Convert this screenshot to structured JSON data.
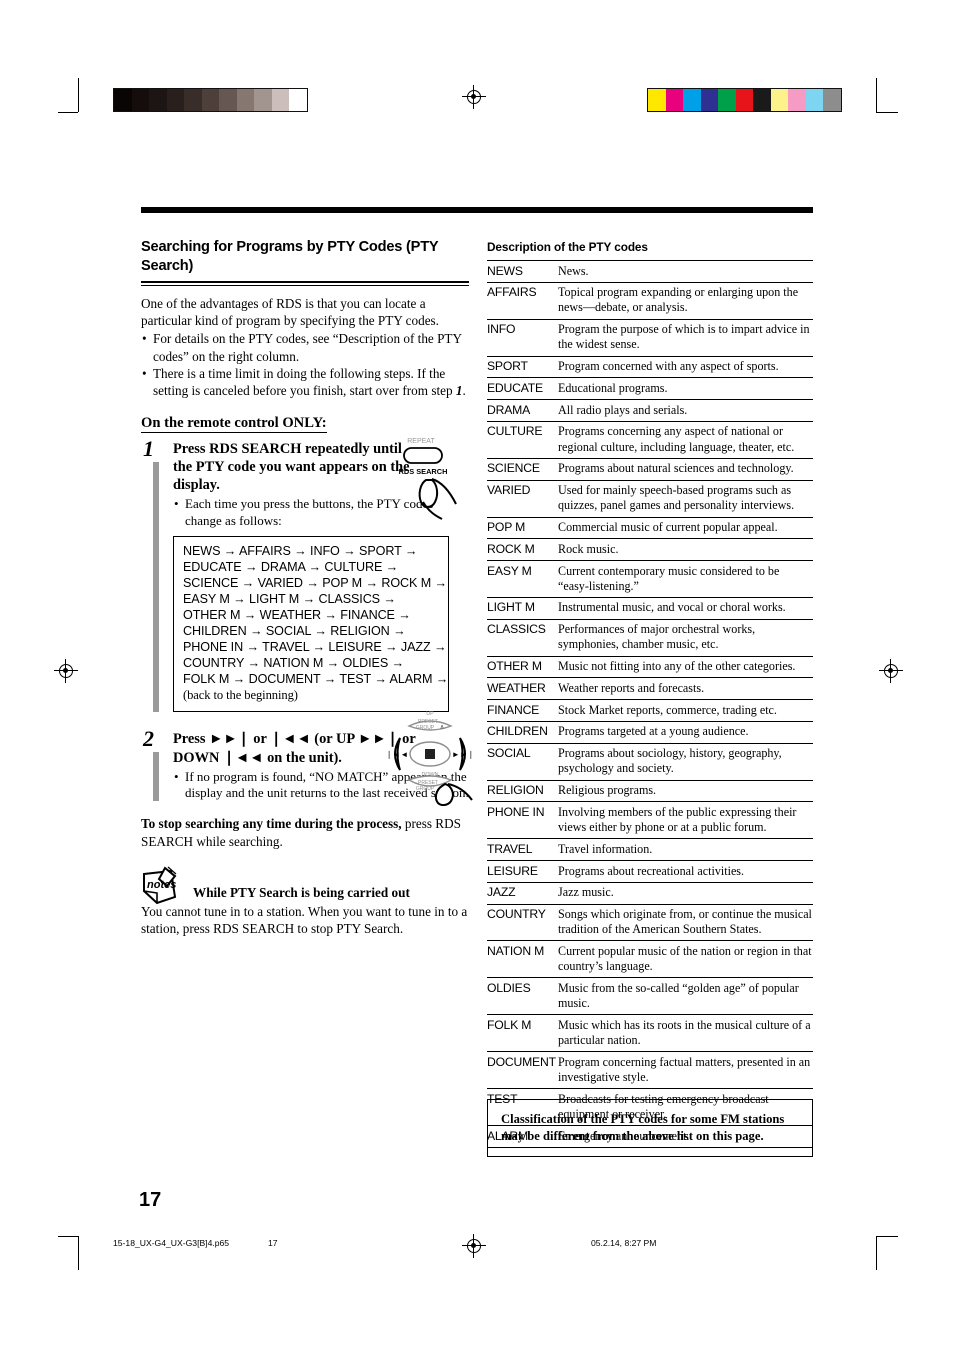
{
  "registration": {
    "gray_ramp": [
      "#0a0505",
      "#140d0c",
      "#1d1513",
      "#291f1d",
      "#392d29",
      "#4d3f3a",
      "#665752",
      "#867771",
      "#a2948f",
      "#cbbebb",
      "#ffffff"
    ],
    "color_patches": [
      "#ffe800",
      "#e8007d",
      "#00a0e9",
      "#2e3192",
      "#00a04b",
      "#e7141a",
      "#1a1a1a",
      "#fdf18c",
      "#f59bc4",
      "#7ed5f2",
      "#8d8d8d"
    ]
  },
  "left": {
    "title": "Searching for Programs by PTY Codes (PTY Search)",
    "intro": "One of the advantages of RDS is that you can locate a particular kind of program by specifying the PTY codes.",
    "intro_bullets": [
      "For details on the PTY codes, see “Description of the PTY codes” on the right column.",
      "There is a time limit in doing the following steps. If the setting is canceled before you finish, start over from step "
    ],
    "bullet2_step_ref": "1",
    "bullet2_tail": ".",
    "remote_only_heading": "On the remote control ONLY:",
    "step1": {
      "number": "1",
      "heading": "Press RDS SEARCH repeatedly until the PTY code you want appears on the display.",
      "bullet": "Each time you press the buttons, the PTY codes change as follows:"
    },
    "flow": {
      "lines": [
        "NEWS → AFFAIRS → INFO → SPORT →",
        "EDUCATE → DRAMA → CULTURE →",
        "SCIENCE → VARIED → POP M → ROCK M →",
        "EASY M → LIGHT M → CLASSICS →",
        "OTHER M → WEATHER → FINANCE →",
        "CHILDREN → SOCIAL → RELIGION →",
        "PHONE IN → TRAVEL → LEISURE → JAZZ →",
        "COUNTRY → NATION M → OLDIES →",
        "FOLK M → DOCUMENT → TEST → ALARM →"
      ],
      "footer": "(back to the beginning)"
    },
    "step2": {
      "number": "2",
      "heading": "Press ►►❘ or ❘◄◄ (or UP ►►❘ or DOWN ❘◄◄ on the unit).",
      "bullet": "If no program is found, “NO MATCH” appears on the display and the unit returns to the last received station."
    },
    "stop_note_bold": "To stop searching any time during the process,",
    "stop_note_rest": " press RDS SEARCH while searching.",
    "notes": {
      "icon_label": "notes",
      "title": "While PTY Search is being carried out",
      "text": "You cannot tune in to a station. When you want to tune in to a station, press RDS SEARCH to stop PTY Search."
    },
    "illustrations": {
      "rds_button": {
        "top_label": "REPEAT",
        "bottom_label": "RDS SEARCH"
      },
      "dpad": {
        "up_label": "UP",
        "up_sub1": "PRESET",
        "up_sub2": "GROUP",
        "up_arrow": "∧",
        "down_label": "DOWN",
        "down_sub1": "PRESET",
        "down_sub2": "GROUP",
        "down_arrow": "∨",
        "left_label": "❘◄◄",
        "right_label": "►►❘"
      }
    }
  },
  "right": {
    "table_title": "Description of the PTY codes",
    "rows": [
      {
        "code": "NEWS",
        "desc": "News."
      },
      {
        "code": "AFFAIRS",
        "desc": "Topical program expanding or enlarging upon the news—debate, or analysis."
      },
      {
        "code": "INFO",
        "desc": "Program the purpose of which is to impart advice in the widest sense."
      },
      {
        "code": "SPORT",
        "desc": "Program concerned with any aspect of sports."
      },
      {
        "code": "EDUCATE",
        "desc": "Educational programs."
      },
      {
        "code": "DRAMA",
        "desc": "All radio plays and serials."
      },
      {
        "code": "CULTURE",
        "desc": "Programs concerning any aspect of national or regional culture, including language, theater, etc."
      },
      {
        "code": "SCIENCE",
        "desc": "Programs about natural sciences and technology."
      },
      {
        "code": "VARIED",
        "desc": "Used for mainly speech-based programs such as quizzes, panel games and personality interviews."
      },
      {
        "code": "POP M",
        "desc": "Commercial music of current popular appeal."
      },
      {
        "code": "ROCK M",
        "desc": "Rock music."
      },
      {
        "code": "EASY M",
        "desc": "Current contemporary music considered to be “easy-listening.”"
      },
      {
        "code": "LIGHT M",
        "desc": "Instrumental music, and vocal or choral works."
      },
      {
        "code": "CLASSICS",
        "desc": "Performances of major orchestral works, symphonies, chamber music, etc."
      },
      {
        "code": "OTHER M",
        "desc": "Music not fitting into any of the other categories."
      },
      {
        "code": "WEATHER",
        "desc": "Weather reports and forecasts."
      },
      {
        "code": "FINANCE",
        "desc": "Stock Market reports, commerce, trading etc."
      },
      {
        "code": "CHILDREN",
        "desc": "Programs targeted at a young audience."
      },
      {
        "code": "SOCIAL",
        "desc": "Programs about sociology, history, geography, psychology and society."
      },
      {
        "code": "RELIGION",
        "desc": "Religious programs."
      },
      {
        "code": "PHONE IN",
        "desc": "Involving members of the public expressing their views either by phone or at a public forum."
      },
      {
        "code": "TRAVEL",
        "desc": "Travel information."
      },
      {
        "code": "LEISURE",
        "desc": "Programs about recreational activities."
      },
      {
        "code": "JAZZ",
        "desc": "Jazz music."
      },
      {
        "code": "COUNTRY",
        "desc": "Songs which originate from, or continue the musical tradition of the American Southern States."
      },
      {
        "code": "NATION M",
        "desc": "Current popular music of the nation or region in that country’s language."
      },
      {
        "code": "OLDIES",
        "desc": "Music from the so-called “golden age” of popular music."
      },
      {
        "code": "FOLK M",
        "desc": "Music which has its roots in the musical culture of a particular nation."
      },
      {
        "code": "DOCUMENT",
        "desc": "Program concerning factual matters, presented in an investigative style."
      },
      {
        "code": "TEST",
        "desc": "Broadcasts for testing emergency broadcast equipment or receiver."
      },
      {
        "code": "ALARM",
        "desc": "Emergency announcement."
      }
    ],
    "classification_note": "Classification of the PTY codes for some FM stations may be different from the above list on this page."
  },
  "page_number": "17",
  "footer": {
    "file": "15-18_UX-G4_UX-G3[B]4.p65",
    "page": "17",
    "date": "05.2.14, 8:27 PM"
  }
}
